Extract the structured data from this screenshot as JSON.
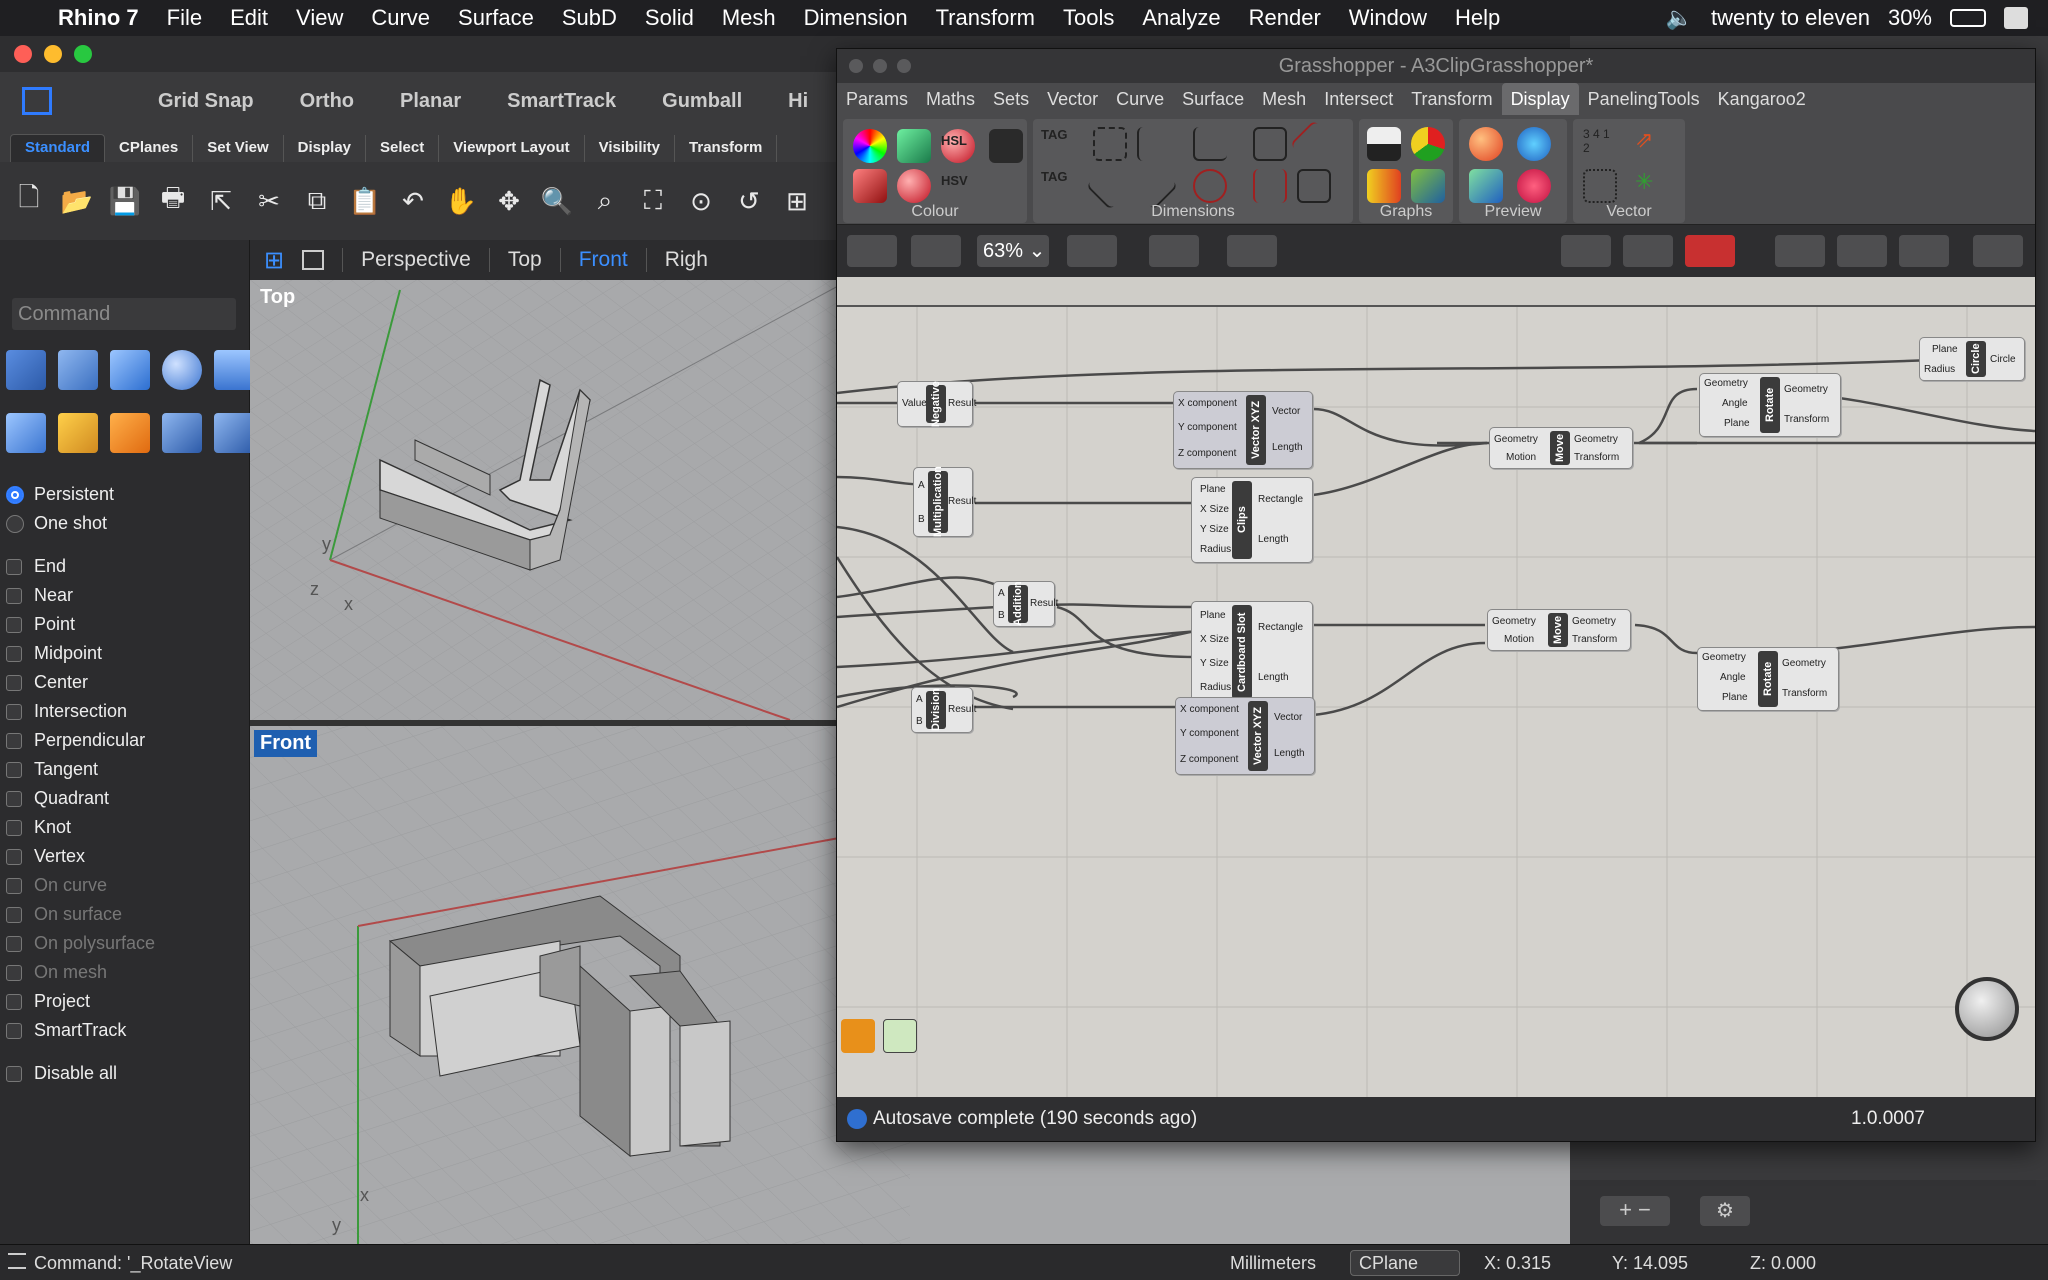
{
  "menubar": {
    "app": "Rhino 7",
    "items": [
      "File",
      "Edit",
      "View",
      "Curve",
      "Surface",
      "SubD",
      "Solid",
      "Mesh",
      "Dimension",
      "Transform",
      "Tools",
      "Analyze",
      "Render",
      "Window",
      "Help"
    ],
    "network": "twenty to eleven",
    "battery": "30%"
  },
  "rhino": {
    "toolbar1": [
      "Grid Snap",
      "Ortho",
      "Planar",
      "SmartTrack",
      "Gumball",
      "Hi"
    ],
    "tabs": [
      "Standard",
      "CPlanes",
      "Set View",
      "Display",
      "Select",
      "Viewport Layout",
      "Visibility",
      "Transform"
    ],
    "command_placeholder": "Command",
    "osnap_modes": [
      {
        "label": "Persistent",
        "type": "radio",
        "on": true
      },
      {
        "label": "One shot",
        "type": "radio",
        "on": false
      }
    ],
    "osnaps": [
      "End",
      "Near",
      "Point",
      "Midpoint",
      "Center",
      "Intersection",
      "Perpendicular",
      "Tangent",
      "Quadrant",
      "Knot",
      "Vertex"
    ],
    "osnaps_dim": [
      "On curve",
      "On surface",
      "On polysurface",
      "On mesh"
    ],
    "osnaps_extra": [
      "Project",
      "SmartTrack"
    ],
    "disable_all": "Disable all",
    "view_tabs": [
      "Perspective",
      "Top",
      "Front",
      "Righ"
    ],
    "active_view_tab": "Front",
    "viewport_top_label": "Top",
    "viewport_front_label": "Front"
  },
  "status": {
    "command": "Command: '_RotateView",
    "units": "Millimeters",
    "cplane": "CPlane",
    "x": "X: 0.315",
    "y": "Y: 14.095",
    "z": "Z: 0.000"
  },
  "grasshopper": {
    "title": "Grasshopper - A3ClipGrasshopper*",
    "menu": [
      "Params",
      "Maths",
      "Sets",
      "Vector",
      "Curve",
      "Surface",
      "Mesh",
      "Intersect",
      "Transform",
      "Display",
      "PanelingTools",
      "Kangaroo2"
    ],
    "active_menu": "Display",
    "groups": [
      "Colour",
      "Dimensions",
      "Graphs",
      "Preview",
      "Vector"
    ],
    "zoom": "63%",
    "status": "Autosave complete (190 seconds ago)",
    "version": "1.0.0007",
    "nodes": {
      "negative": {
        "name": "Negative",
        "in": [
          "Value"
        ],
        "out": [
          "Result"
        ]
      },
      "multiplication": {
        "name": "Multiplication",
        "in": [
          "A",
          "B"
        ],
        "out": [
          "Result"
        ]
      },
      "addition": {
        "name": "Addition",
        "in": [
          "A",
          "B"
        ],
        "out": [
          "Result"
        ]
      },
      "division": {
        "name": "Division",
        "in": [
          "A",
          "B"
        ],
        "out": [
          "Result"
        ]
      },
      "vector1": {
        "name": "Vector XYZ",
        "in": [
          "X component",
          "Y component",
          "Z component"
        ],
        "out": [
          "Vector",
          "Length"
        ]
      },
      "vector2": {
        "name": "Vector XYZ",
        "in": [
          "X component",
          "Y component",
          "Z component"
        ],
        "out": [
          "Vector",
          "Length"
        ]
      },
      "clips": {
        "name": "Clips",
        "in": [
          "Plane",
          "X Size",
          "Y Size",
          "Radius"
        ],
        "out": [
          "Rectangle",
          "Length"
        ]
      },
      "cardboard": {
        "name": "Cardboard Slot",
        "in": [
          "Plane",
          "X Size",
          "Y Size",
          "Radius"
        ],
        "out": [
          "Rectangle",
          "Length"
        ]
      },
      "move1": {
        "name": "Move",
        "in": [
          "Geometry",
          "Motion"
        ],
        "out": [
          "Geometry",
          "Transform"
        ]
      },
      "move2": {
        "name": "Move",
        "in": [
          "Geometry",
          "Motion"
        ],
        "out": [
          "Geometry",
          "Transform"
        ]
      },
      "rotate1": {
        "name": "Rotate",
        "in": [
          "Geometry",
          "Angle",
          "Plane"
        ],
        "out": [
          "Geometry",
          "Transform"
        ]
      },
      "rotate2": {
        "name": "Rotate",
        "in": [
          "Geometry",
          "Angle",
          "Plane"
        ],
        "out": [
          "Geometry",
          "Transform"
        ]
      },
      "circle": {
        "name": "Circle",
        "in": [
          "Plane",
          "Radius"
        ],
        "out": [
          "Circle"
        ]
      }
    }
  }
}
